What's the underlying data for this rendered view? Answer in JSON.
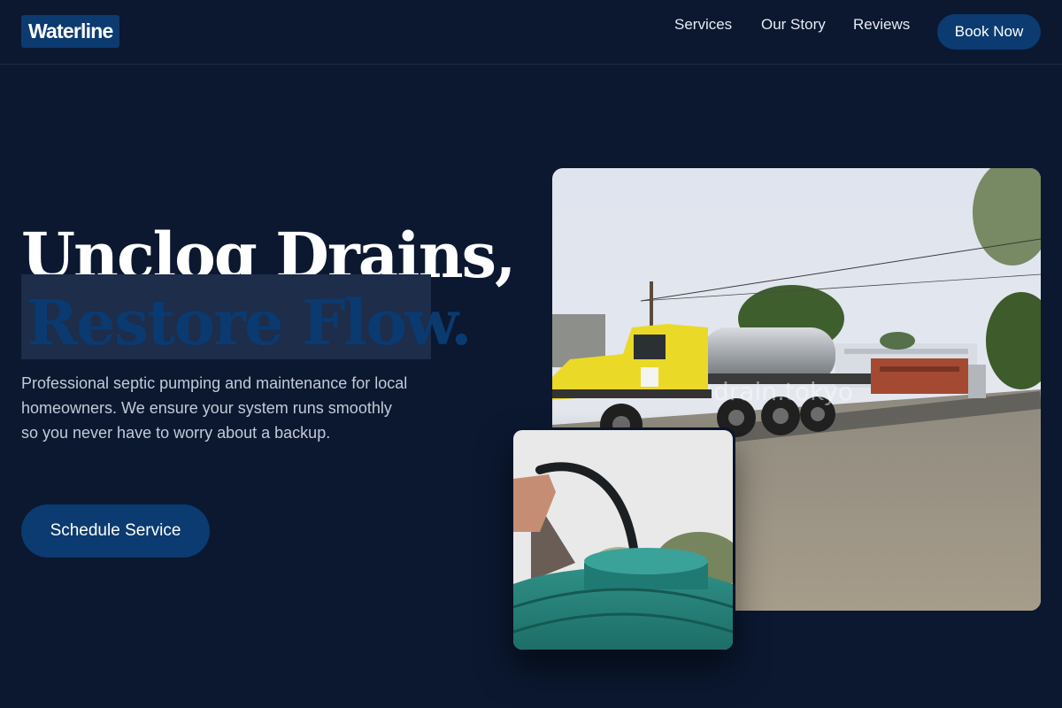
{
  "brand": {
    "name": "Waterline"
  },
  "nav": {
    "items": [
      "Services",
      "Our Story",
      "Reviews"
    ],
    "cta_label": "Book Now"
  },
  "hero": {
    "headline_line1": "Unclog Drains,",
    "headline_line2": "Restore Flow.",
    "description": "Professional septic pumping and maintenance for local homeowners. We ensure your system runs smoothly so you never have to worry about a backup.",
    "cta_label": "Schedule Service"
  },
  "images": {
    "main_watermark": "drain.tokyo"
  },
  "colors": {
    "background": "#0b1830",
    "accent": "#0b3b70",
    "text": "#ffffff",
    "muted_text": "#c3cad8"
  }
}
